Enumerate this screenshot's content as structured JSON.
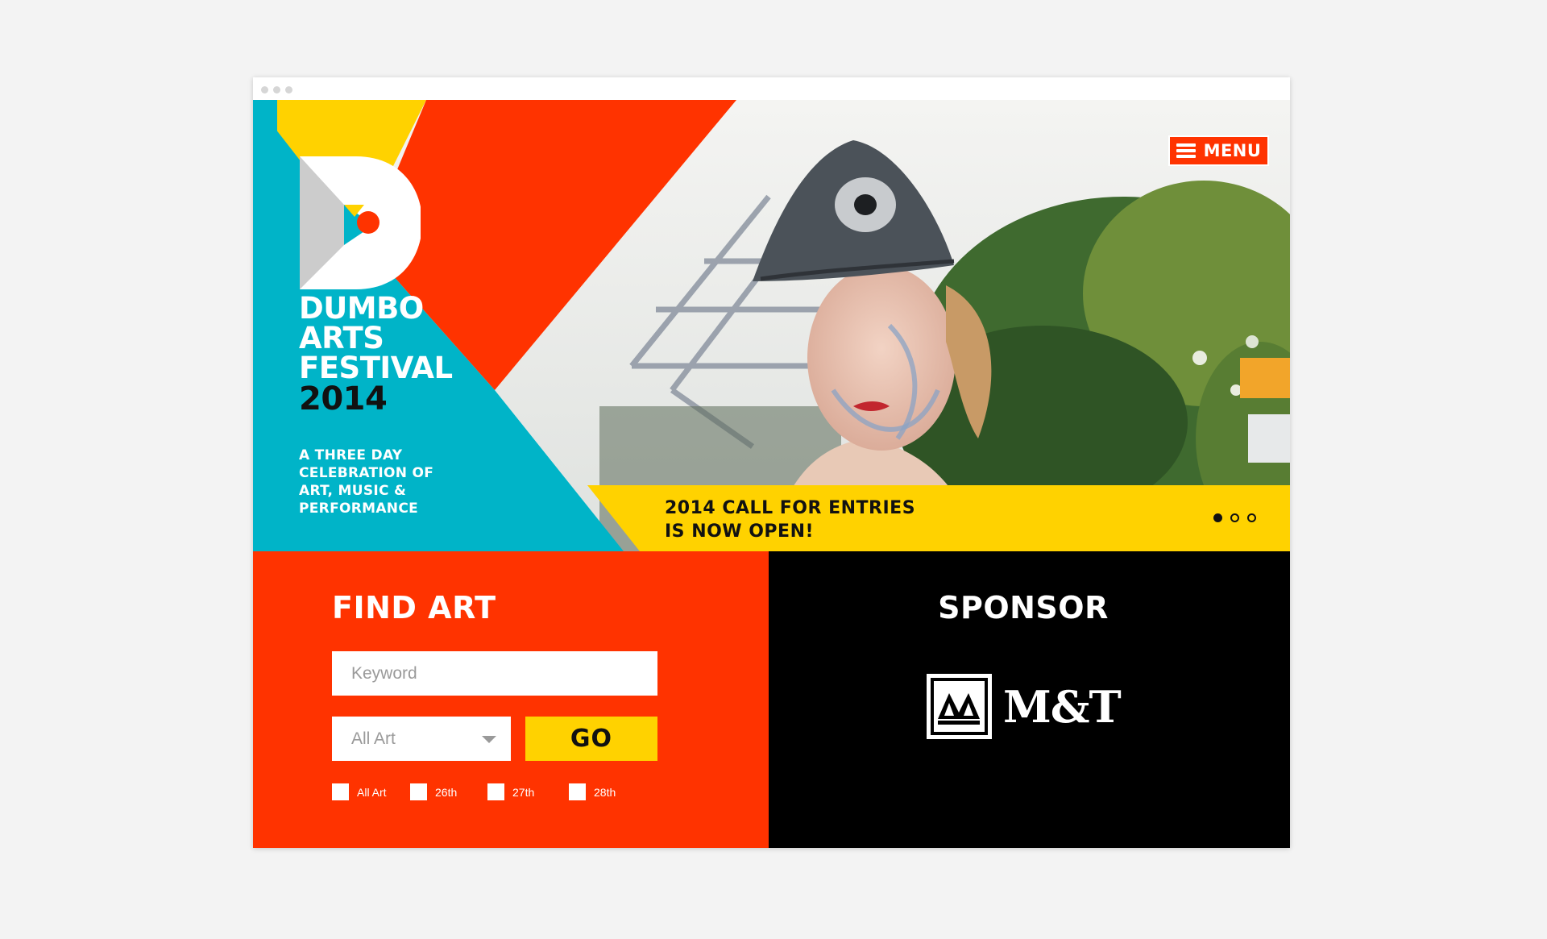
{
  "header": {
    "menu_label": "MENU"
  },
  "hero": {
    "logo_letter": "D",
    "title_lines": [
      "DUMBO",
      "ARTS",
      "FESTIVAL"
    ],
    "year": "2014",
    "tagline_lines": [
      "A THREE DAY",
      "CELEBRATION OF",
      "ART, MUSIC &",
      "PERFORMANCE"
    ],
    "banner_lines": [
      "2014 CALL FOR ENTRIES",
      "IS NOW OPEN!"
    ],
    "slides": {
      "count": 3,
      "active_index": 0
    }
  },
  "find_art": {
    "title": "FIND ART",
    "keyword_placeholder": "Keyword",
    "select_value": "All Art",
    "go_label": "GO",
    "checkboxes": [
      "All Art",
      "26th",
      "27th",
      "28th"
    ]
  },
  "sponsor": {
    "title": "SPONSOR",
    "logo_text": "M&T"
  },
  "colors": {
    "red": "#ff3300",
    "yellow": "#ffd200",
    "teal": "#00b4c8",
    "black": "#000000",
    "white": "#ffffff",
    "gray": "#cccccc"
  },
  "icons": {
    "menu": "hamburger-icon",
    "select": "chevron-down-icon",
    "sponsor": "mt-bank-icon"
  }
}
